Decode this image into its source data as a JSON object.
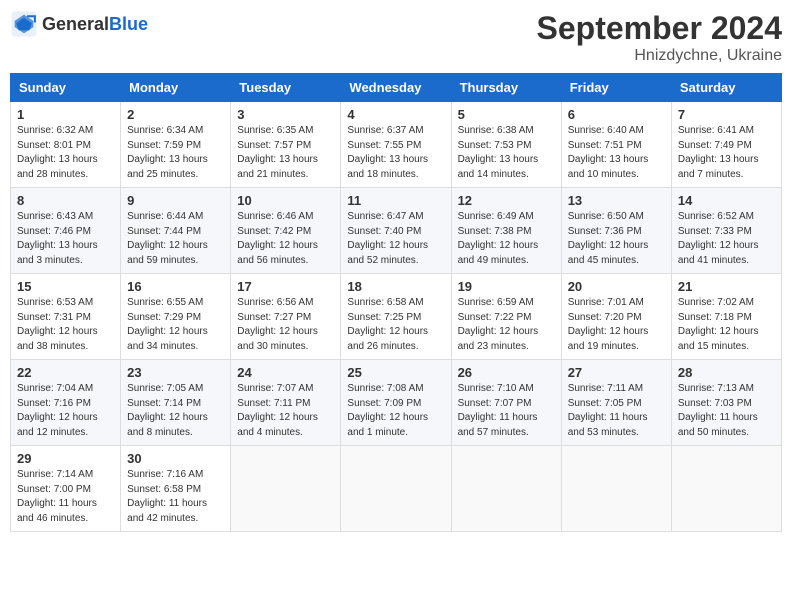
{
  "header": {
    "logo_general": "General",
    "logo_blue": "Blue",
    "title": "September 2024",
    "subtitle": "Hnizdychne, Ukraine"
  },
  "weekdays": [
    "Sunday",
    "Monday",
    "Tuesday",
    "Wednesday",
    "Thursday",
    "Friday",
    "Saturday"
  ],
  "weeks": [
    [
      {
        "day": "1",
        "sunrise": "6:32 AM",
        "sunset": "8:01 PM",
        "daylight": "13 hours and 28 minutes."
      },
      {
        "day": "2",
        "sunrise": "6:34 AM",
        "sunset": "7:59 PM",
        "daylight": "13 hours and 25 minutes."
      },
      {
        "day": "3",
        "sunrise": "6:35 AM",
        "sunset": "7:57 PM",
        "daylight": "13 hours and 21 minutes."
      },
      {
        "day": "4",
        "sunrise": "6:37 AM",
        "sunset": "7:55 PM",
        "daylight": "13 hours and 18 minutes."
      },
      {
        "day": "5",
        "sunrise": "6:38 AM",
        "sunset": "7:53 PM",
        "daylight": "13 hours and 14 minutes."
      },
      {
        "day": "6",
        "sunrise": "6:40 AM",
        "sunset": "7:51 PM",
        "daylight": "13 hours and 10 minutes."
      },
      {
        "day": "7",
        "sunrise": "6:41 AM",
        "sunset": "7:49 PM",
        "daylight": "13 hours and 7 minutes."
      }
    ],
    [
      {
        "day": "8",
        "sunrise": "6:43 AM",
        "sunset": "7:46 PM",
        "daylight": "13 hours and 3 minutes."
      },
      {
        "day": "9",
        "sunrise": "6:44 AM",
        "sunset": "7:44 PM",
        "daylight": "12 hours and 59 minutes."
      },
      {
        "day": "10",
        "sunrise": "6:46 AM",
        "sunset": "7:42 PM",
        "daylight": "12 hours and 56 minutes."
      },
      {
        "day": "11",
        "sunrise": "6:47 AM",
        "sunset": "7:40 PM",
        "daylight": "12 hours and 52 minutes."
      },
      {
        "day": "12",
        "sunrise": "6:49 AM",
        "sunset": "7:38 PM",
        "daylight": "12 hours and 49 minutes."
      },
      {
        "day": "13",
        "sunrise": "6:50 AM",
        "sunset": "7:36 PM",
        "daylight": "12 hours and 45 minutes."
      },
      {
        "day": "14",
        "sunrise": "6:52 AM",
        "sunset": "7:33 PM",
        "daylight": "12 hours and 41 minutes."
      }
    ],
    [
      {
        "day": "15",
        "sunrise": "6:53 AM",
        "sunset": "7:31 PM",
        "daylight": "12 hours and 38 minutes."
      },
      {
        "day": "16",
        "sunrise": "6:55 AM",
        "sunset": "7:29 PM",
        "daylight": "12 hours and 34 minutes."
      },
      {
        "day": "17",
        "sunrise": "6:56 AM",
        "sunset": "7:27 PM",
        "daylight": "12 hours and 30 minutes."
      },
      {
        "day": "18",
        "sunrise": "6:58 AM",
        "sunset": "7:25 PM",
        "daylight": "12 hours and 26 minutes."
      },
      {
        "day": "19",
        "sunrise": "6:59 AM",
        "sunset": "7:22 PM",
        "daylight": "12 hours and 23 minutes."
      },
      {
        "day": "20",
        "sunrise": "7:01 AM",
        "sunset": "7:20 PM",
        "daylight": "12 hours and 19 minutes."
      },
      {
        "day": "21",
        "sunrise": "7:02 AM",
        "sunset": "7:18 PM",
        "daylight": "12 hours and 15 minutes."
      }
    ],
    [
      {
        "day": "22",
        "sunrise": "7:04 AM",
        "sunset": "7:16 PM",
        "daylight": "12 hours and 12 minutes."
      },
      {
        "day": "23",
        "sunrise": "7:05 AM",
        "sunset": "7:14 PM",
        "daylight": "12 hours and 8 minutes."
      },
      {
        "day": "24",
        "sunrise": "7:07 AM",
        "sunset": "7:11 PM",
        "daylight": "12 hours and 4 minutes."
      },
      {
        "day": "25",
        "sunrise": "7:08 AM",
        "sunset": "7:09 PM",
        "daylight": "12 hours and 1 minute."
      },
      {
        "day": "26",
        "sunrise": "7:10 AM",
        "sunset": "7:07 PM",
        "daylight": "11 hours and 57 minutes."
      },
      {
        "day": "27",
        "sunrise": "7:11 AM",
        "sunset": "7:05 PM",
        "daylight": "11 hours and 53 minutes."
      },
      {
        "day": "28",
        "sunrise": "7:13 AM",
        "sunset": "7:03 PM",
        "daylight": "11 hours and 50 minutes."
      }
    ],
    [
      {
        "day": "29",
        "sunrise": "7:14 AM",
        "sunset": "7:00 PM",
        "daylight": "11 hours and 46 minutes."
      },
      {
        "day": "30",
        "sunrise": "7:16 AM",
        "sunset": "6:58 PM",
        "daylight": "11 hours and 42 minutes."
      },
      null,
      null,
      null,
      null,
      null
    ]
  ]
}
